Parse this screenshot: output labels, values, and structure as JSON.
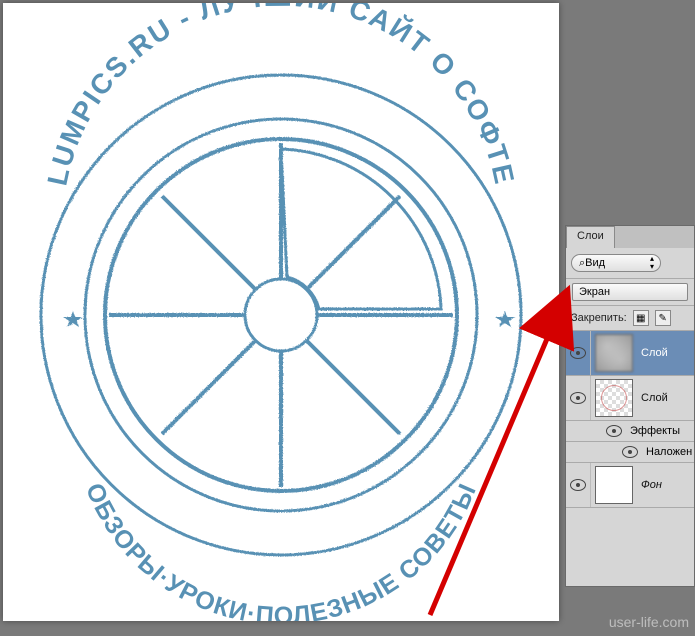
{
  "stamp": {
    "top_text": "LUMPICS.RU - ЛУЧШИЙ САЙТ О СОФТЕ",
    "bottom_text": "ОБЗОРЫ·УРОКИ·ПОЛЕЗНЫЕ СОВЕТЫ",
    "color": "#3b7ea8"
  },
  "panel": {
    "tab_label": "Слои",
    "filter_label": "Вид",
    "blend_mode": "Экран",
    "lock_label": "Закрепить:"
  },
  "layers": {
    "items": [
      {
        "name": "Слой",
        "selected": true,
        "thumb": "clouds"
      },
      {
        "name": "Слой",
        "selected": false,
        "thumb": "transparent"
      }
    ],
    "fx_label": "Эффекты",
    "fx_sub_label": "Наложен",
    "bg_name": "Фон"
  },
  "watermark": "user-life.com"
}
